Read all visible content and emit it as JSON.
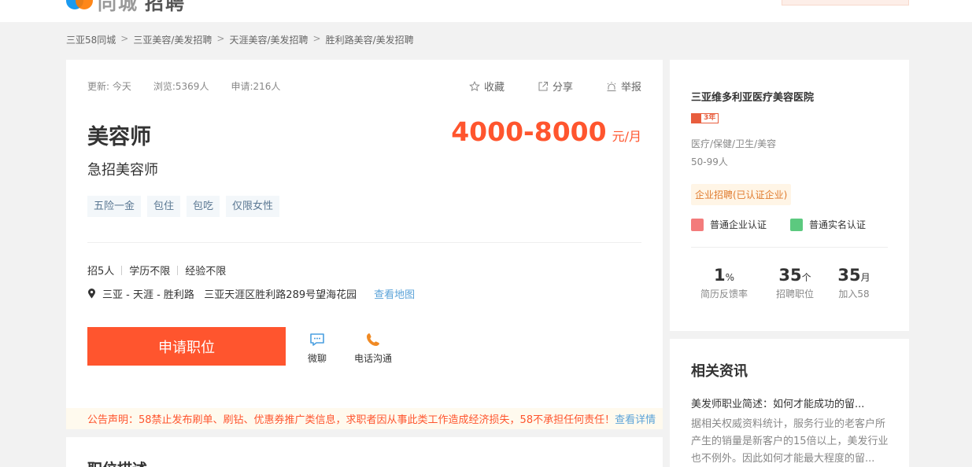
{
  "header": {
    "logo_text": "同城",
    "logo_text2": "招聘"
  },
  "breadcrumb": [
    "三亚58同城",
    "三亚美容/美发招聘",
    "天涯美容/美发招聘",
    "胜利路美容/美发招聘"
  ],
  "job": {
    "updated": "更新: 今天",
    "views": "浏览:5369人",
    "applied": "申请:216人",
    "favorite_label": "收藏",
    "share_label": "分享",
    "report_label": "举报",
    "title": "美容师",
    "salary": "4000-8000",
    "salary_unit": "元/月",
    "subtitle": "急招美容师",
    "tags": [
      "五险一金",
      "包住",
      "包吃",
      "仅限女性"
    ],
    "headcount": "招5人",
    "education": "学历不限",
    "experience": "经验不限",
    "address": "三亚 - 天涯 - 胜利路   三亚天涯区胜利路289号望海花园",
    "map_link": "查看地图",
    "apply_label": "申请职位",
    "chat_label": "微聊",
    "phone_label": "电话沟通",
    "notice": "公告声明：58禁止发布刷单、刷钻、优惠券推广类信息，求职者因从事此类工作造成经济损失，58不承担任何责任！",
    "notice_more": "查看详情",
    "description_title": "职位描述"
  },
  "company": {
    "name": "三亚维多利亚医疗美容医院",
    "years": "3年",
    "industry": "医疗/保健/卫生/美容",
    "size": "50-99人",
    "cert": "企业招聘(已认证企业)",
    "verify1": "普通企业认证",
    "verify2": "普通实名认证",
    "stats": [
      {
        "value": "1",
        "unit": "%",
        "label": "简历反馈率"
      },
      {
        "value": "35",
        "unit": "个",
        "label": "招聘职位"
      },
      {
        "value": "35",
        "unit": "月",
        "label": "加入58"
      }
    ]
  },
  "news": {
    "heading": "相关资讯",
    "title": "美发师职业简述：如何才能成功的留...",
    "body": "据相关权威资料统计，服务行业的老客户所产生的销量是新客户的15倍以上，美发行业也不例外。因此如何才能最大程度的留..."
  },
  "colors": {
    "accent": "#ff552e",
    "link": "#5ba3d8",
    "tag_text": "#5b7893"
  }
}
